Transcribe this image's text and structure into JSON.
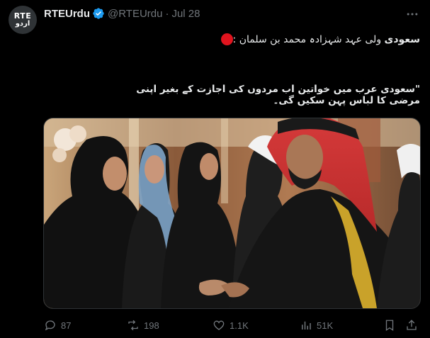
{
  "account": {
    "avatar_top": "RTE",
    "avatar_bottom": "اردو",
    "display_name": "RTEUrdu",
    "handle": "@RTEUrdu",
    "separator": "·",
    "date": "Jul 28",
    "verified_icon": "verified-badge-icon",
    "verified_color": "#1d9bf0"
  },
  "post": {
    "line1_bold": "سعودی",
    "line1_rest": " ولی عہد شہزادہ محمد بن سلمان :",
    "line2": "\"سعودی عرب میں خواتین اب مردوں کی اجازت کے بغیر اپنی مرضی کا لباس پہن سکیں گی۔",
    "bullet_color": "#e0141e"
  },
  "stats": {
    "replies": "87",
    "reposts": "198",
    "likes": "1.1K",
    "views": "51K"
  },
  "icons": {
    "more": "more-dots-icon",
    "reply": "reply-icon",
    "repost": "repost-icon",
    "like": "heart-icon",
    "views": "views-chart-icon",
    "bookmark": "bookmark-icon",
    "share": "share-icon"
  },
  "colors": {
    "background": "#000000",
    "text": "#e7e9ea",
    "muted": "#71767b",
    "border": "#2f3336"
  }
}
